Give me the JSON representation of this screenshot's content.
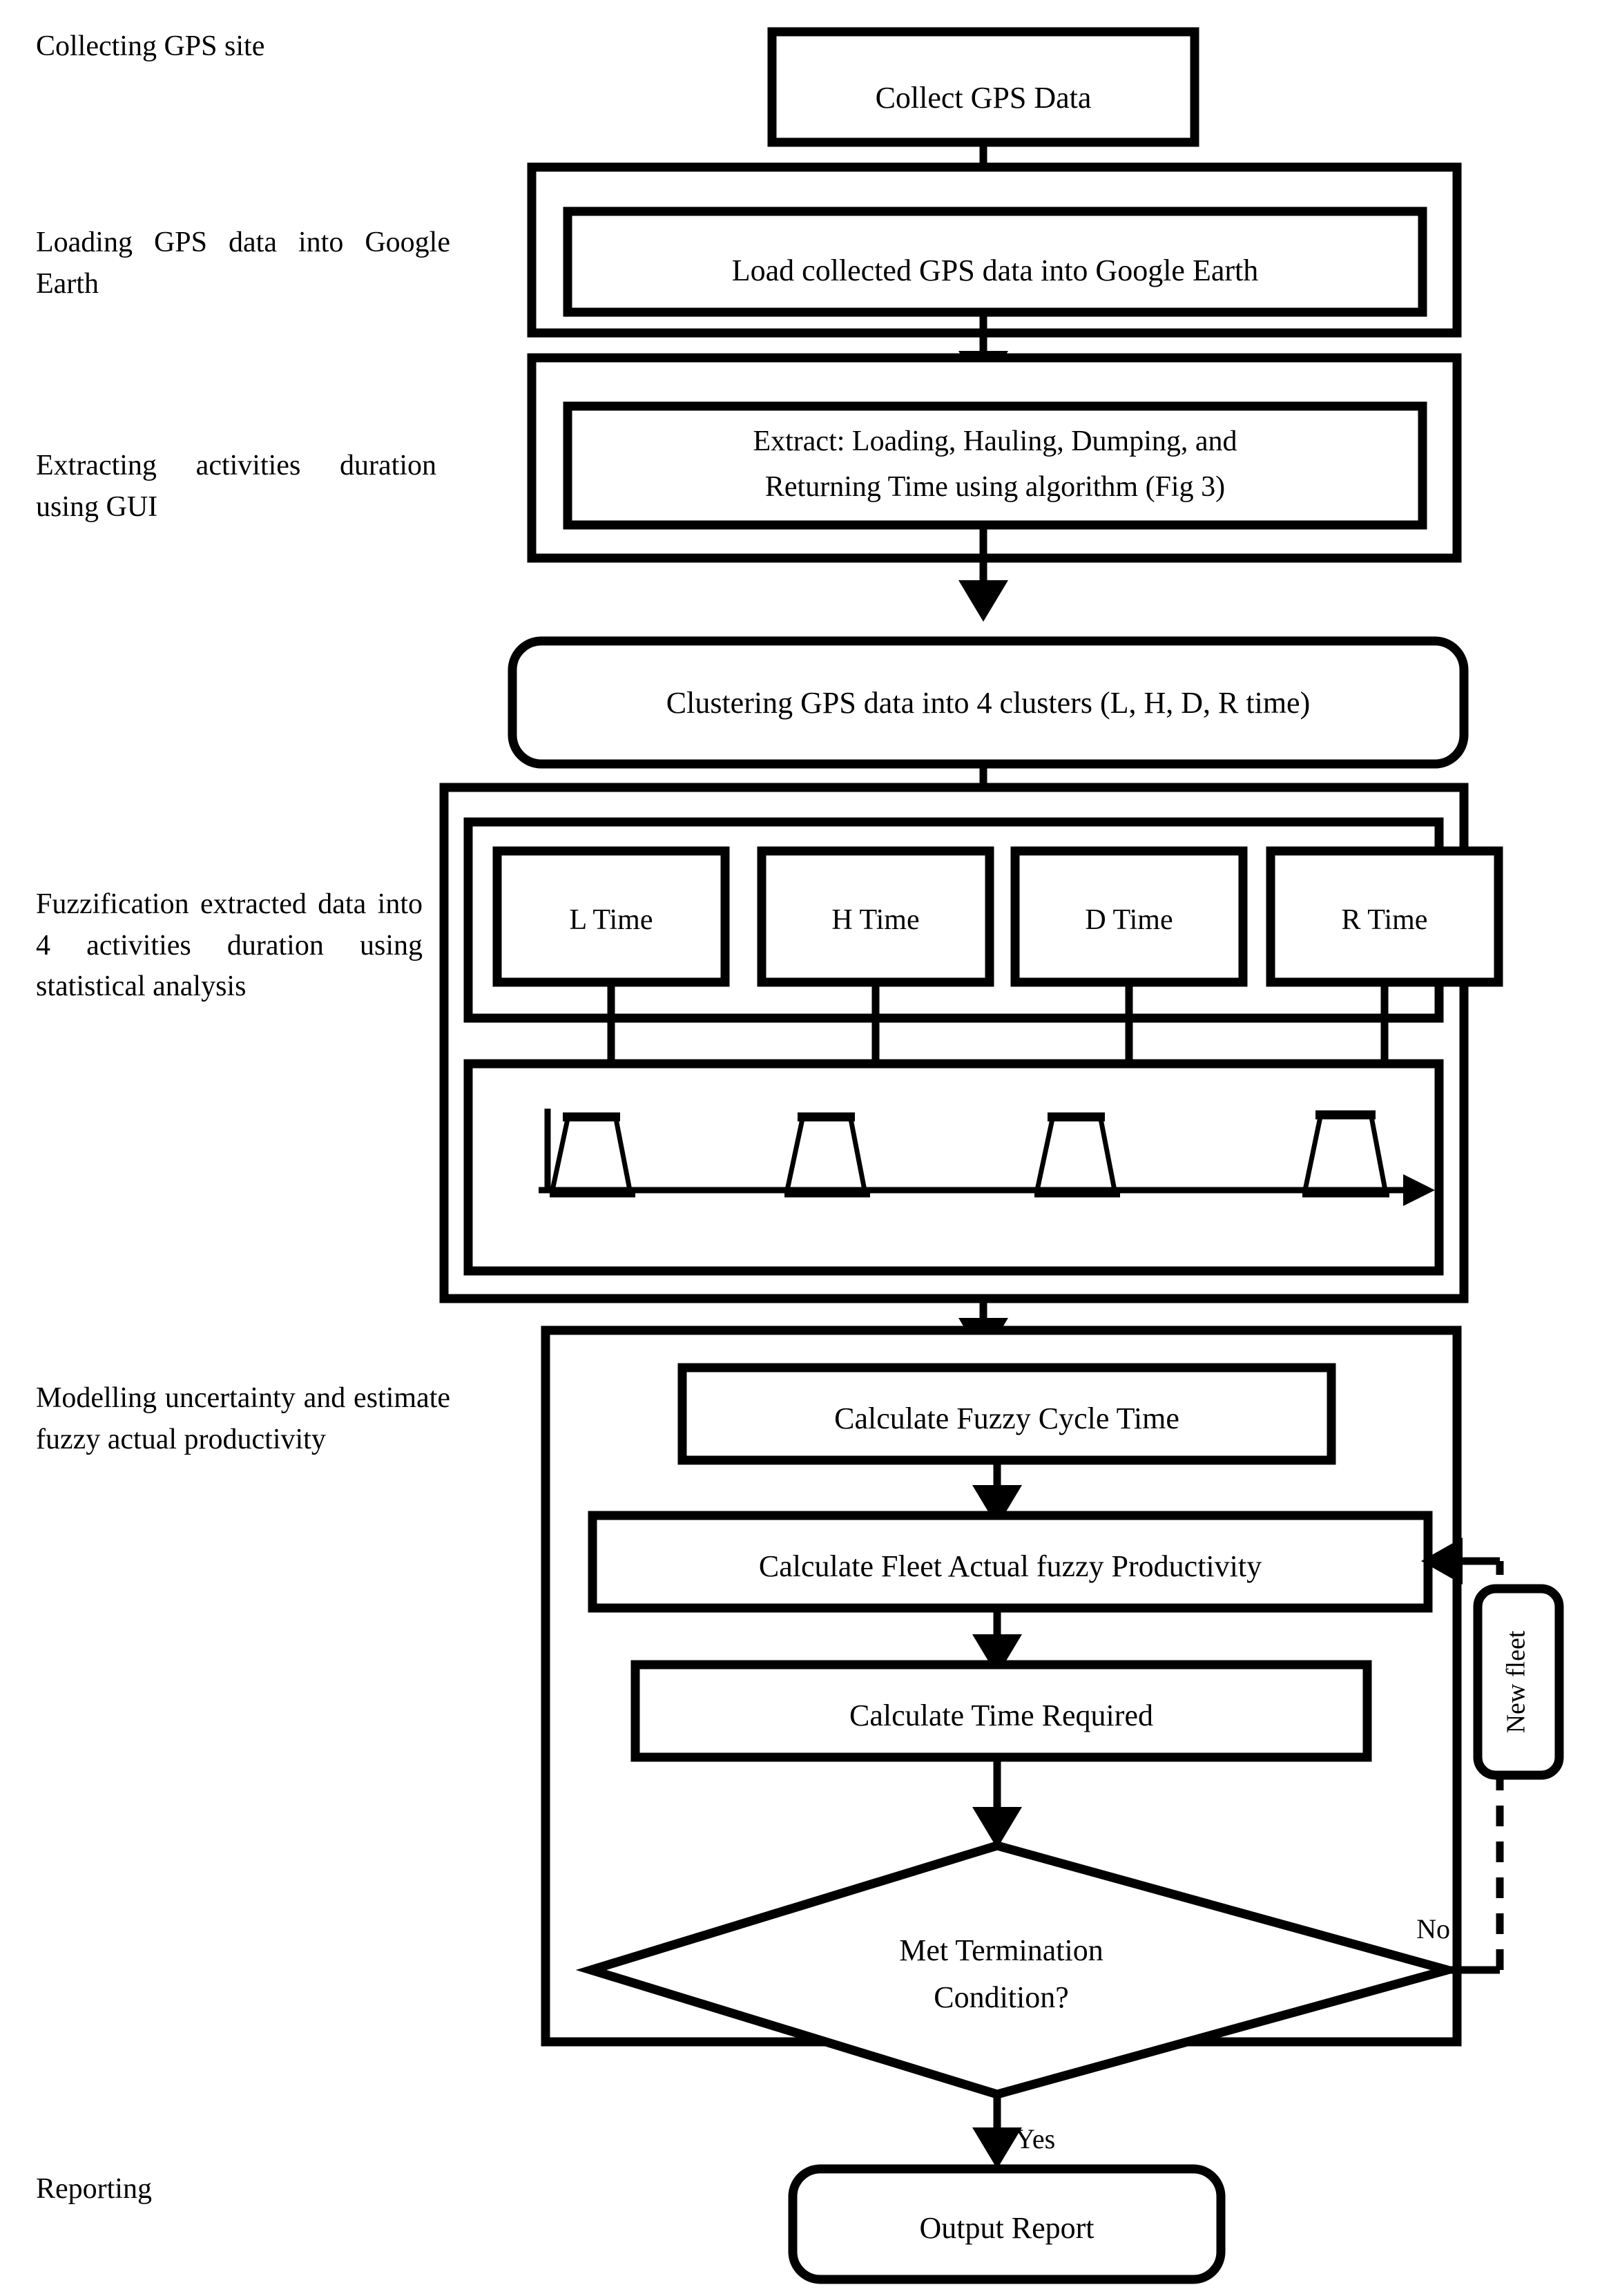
{
  "diagram": {
    "title": "GPS-based fuzzy fleet productivity estimation flowchart",
    "stage_labels": [
      {
        "id": "collecting",
        "text": "Collecting GPS site"
      },
      {
        "id": "loading",
        "text": "Loading GPS data into Google Earth"
      },
      {
        "id": "extracting",
        "text": "Extracting activities duration using GUI"
      },
      {
        "id": "fuzzification",
        "text": "Fuzzification extracted data into 4 activities duration using statistical analysis"
      },
      {
        "id": "modelling",
        "text": "Modelling uncertainty and estimate fuzzy actual productivity"
      },
      {
        "id": "reporting",
        "text": "Reporting"
      }
    ],
    "nodes": [
      {
        "id": "collect-gps-data",
        "text": "Collect GPS Data",
        "shape": "rect"
      },
      {
        "id": "load-into-google-earth",
        "text": "Load collected GPS data into Google Earth",
        "shape": "rect"
      },
      {
        "id": "extract-times-line1",
        "text": "Extract: Loading, Hauling, Dumping, and",
        "shape": "rect"
      },
      {
        "id": "extract-times-line2",
        "text": "Returning Time using algorithm (Fig 3)",
        "shape": "rect"
      },
      {
        "id": "clustering",
        "text": "Clustering GPS data into 4 clusters (L, H, D, R time)",
        "shape": "rounded-rect"
      },
      {
        "id": "l-time",
        "text": "L Time",
        "shape": "rect"
      },
      {
        "id": "h-time",
        "text": "H Time",
        "shape": "rect"
      },
      {
        "id": "d-time",
        "text": "D Time",
        "shape": "rect"
      },
      {
        "id": "r-time",
        "text": "R Time",
        "shape": "rect"
      },
      {
        "id": "calc-fuzzy-cycle-time",
        "text": "Calculate Fuzzy Cycle Time",
        "shape": "rect"
      },
      {
        "id": "calc-fleet-productivity",
        "text": "Calculate Fleet Actual fuzzy Productivity",
        "shape": "rect"
      },
      {
        "id": "calc-time-required",
        "text": "Calculate Time Required",
        "shape": "rect"
      },
      {
        "id": "met-termination-line1",
        "text": "Met Termination",
        "shape": "diamond"
      },
      {
        "id": "met-termination-line2",
        "text": "Condition?",
        "shape": "diamond"
      },
      {
        "id": "new-fleet",
        "text": "New fleet",
        "shape": "rounded-rect-vertical"
      },
      {
        "id": "output-report",
        "text": "Output Report",
        "shape": "rounded-rect"
      }
    ],
    "edge_labels": [
      {
        "id": "no-branch",
        "text": "No"
      },
      {
        "id": "yes-branch",
        "text": "Yes"
      }
    ],
    "membership_plot": {
      "label": "four trapezoidal fuzzy membership functions on a time axis",
      "count": 4
    },
    "colors": {
      "stroke": "#000000",
      "fill": "#ffffff",
      "background": "#ffffff"
    }
  }
}
